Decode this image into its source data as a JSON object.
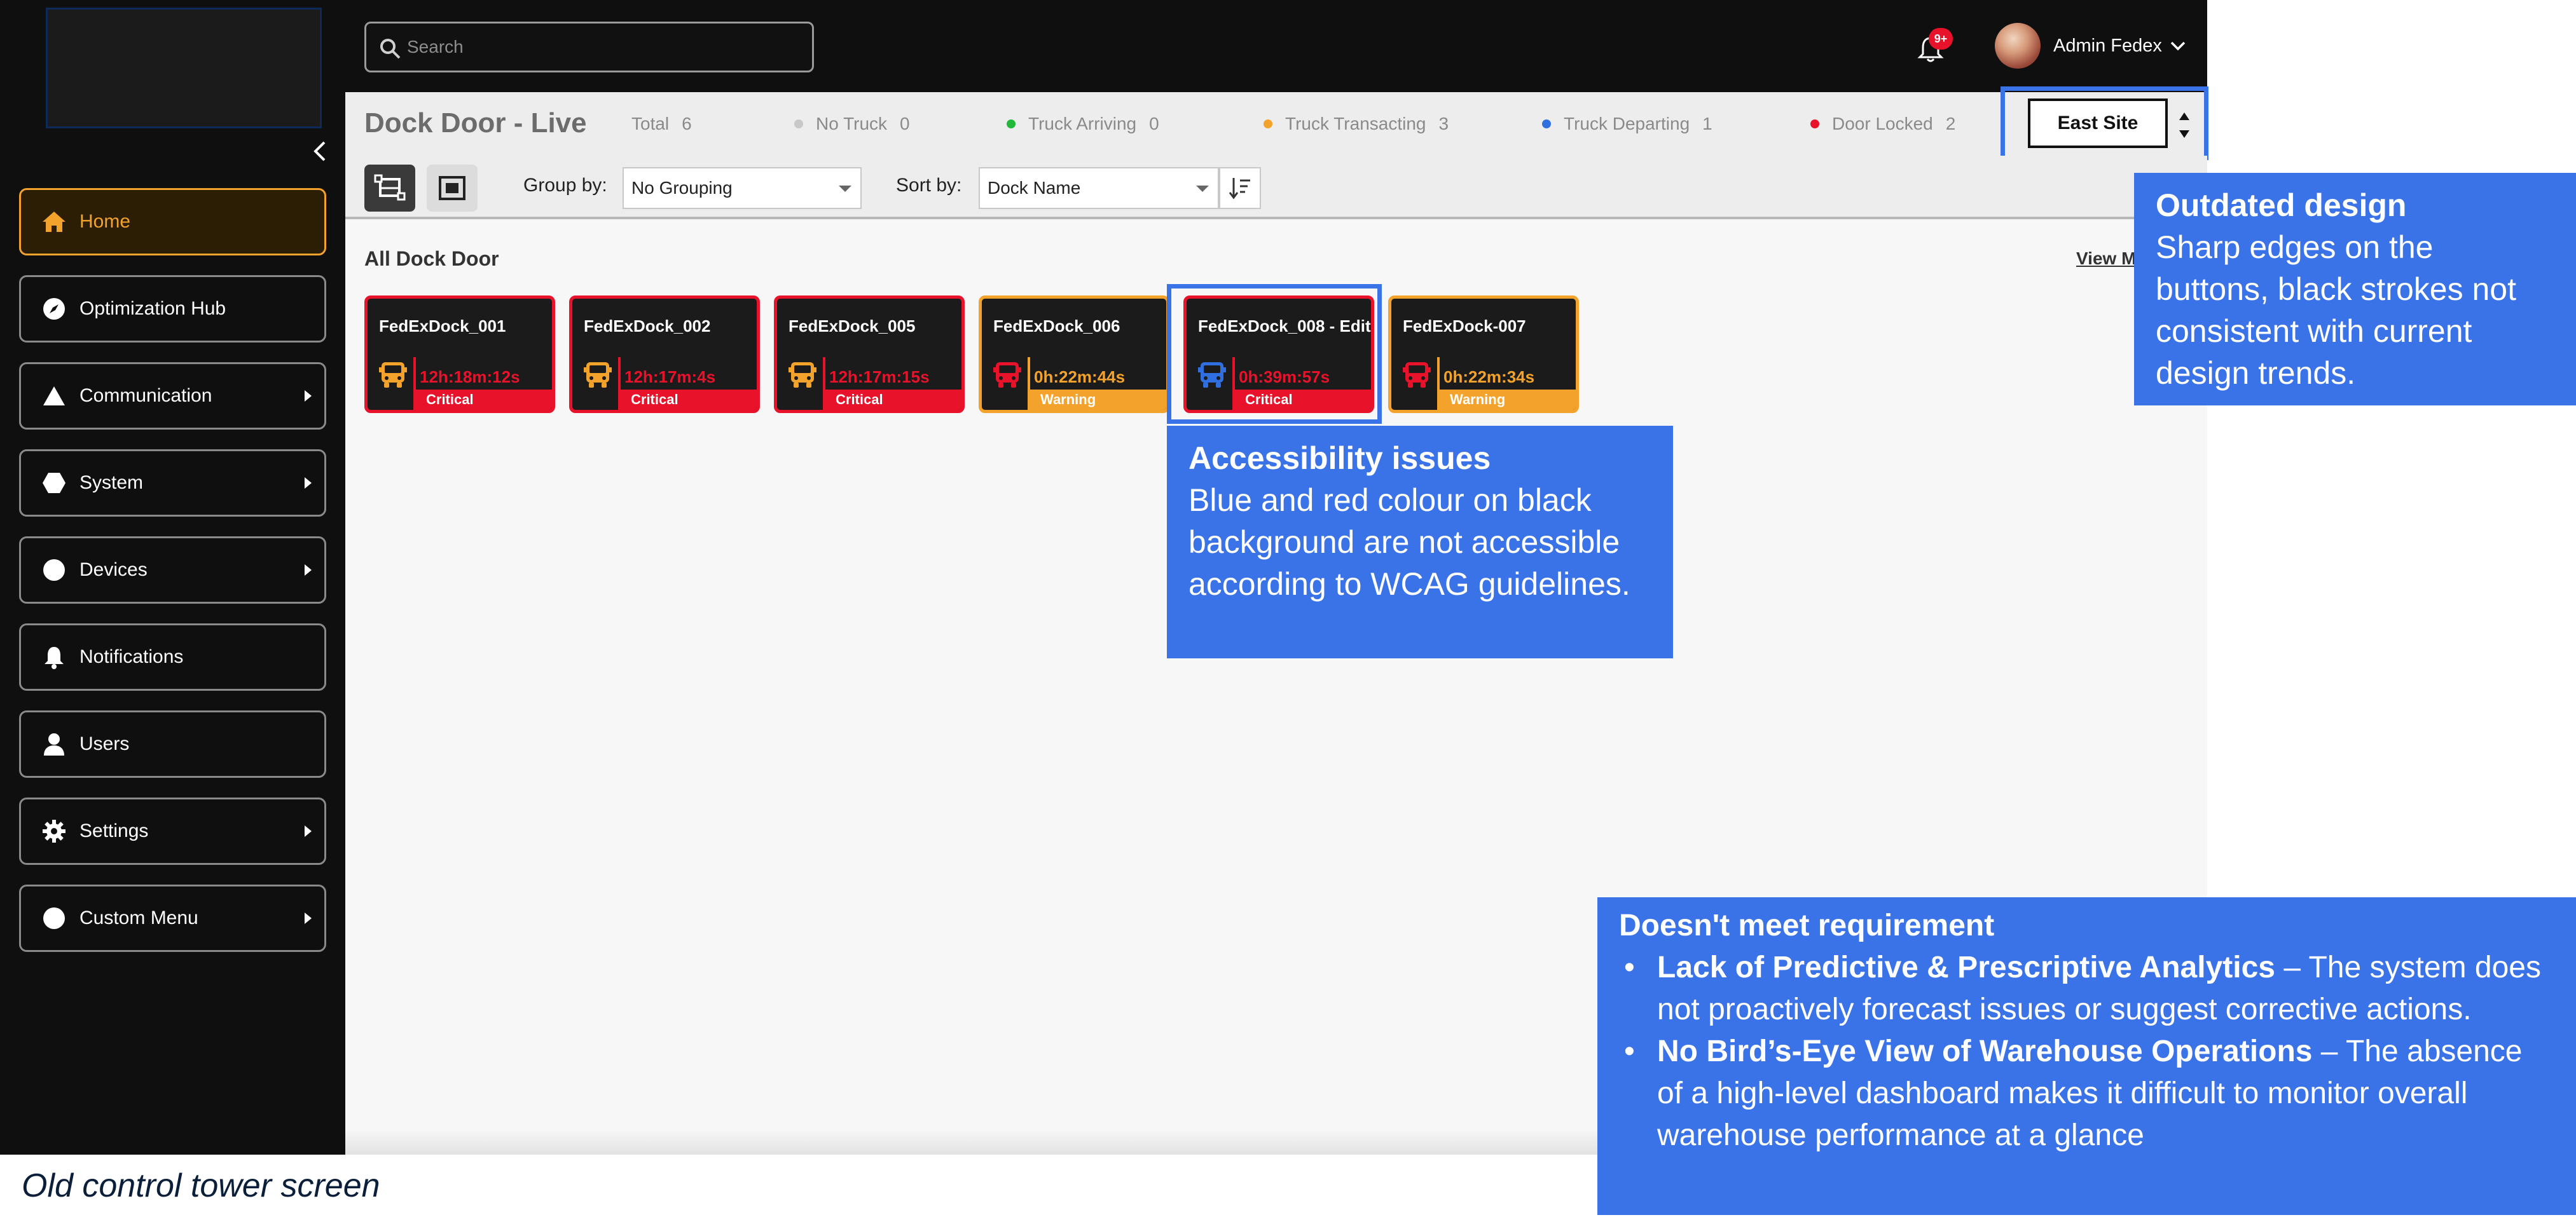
{
  "search": {
    "placeholder": "Search"
  },
  "header": {
    "notification_badge": "9+",
    "user_name": "Admin Fedex"
  },
  "sidebar": {
    "items": [
      {
        "label": "Home",
        "icon": "home-icon",
        "submenu": false
      },
      {
        "label": "Optimization Hub",
        "icon": "compass-icon",
        "submenu": false
      },
      {
        "label": "Communication",
        "icon": "triangle-icon",
        "submenu": true
      },
      {
        "label": "System",
        "icon": "hexagon-icon",
        "submenu": true
      },
      {
        "label": "Devices",
        "icon": "circle-icon",
        "submenu": true
      },
      {
        "label": "Notifications",
        "icon": "bell-icon",
        "submenu": false
      },
      {
        "label": "Users",
        "icon": "user-icon",
        "submenu": false
      },
      {
        "label": "Settings",
        "icon": "gear-icon",
        "submenu": true
      },
      {
        "label": "Custom Menu",
        "icon": "circle-icon",
        "submenu": true
      }
    ]
  },
  "status_bar": {
    "title": "Dock Door - Live",
    "total_label": "Total",
    "total_value": "6",
    "stats": [
      {
        "label": "No Truck",
        "value": "0",
        "color": "#c8c8c8"
      },
      {
        "label": "Truck Arriving",
        "value": "0",
        "color": "#22b83a"
      },
      {
        "label": "Truck Transacting",
        "value": "3",
        "color": "#f3a32b"
      },
      {
        "label": "Truck Departing",
        "value": "1",
        "color": "#2f6fe0"
      },
      {
        "label": "Door Locked",
        "value": "2",
        "color": "#e8122a"
      }
    ],
    "site": "East Site"
  },
  "toolbar": {
    "group_label": "Group by:",
    "group_value": "No Grouping",
    "sort_label": "Sort by:",
    "sort_value": "Dock Name"
  },
  "section": {
    "title": "All Dock Door",
    "view_more": "View More"
  },
  "docks": [
    {
      "name": "FedExDock_001",
      "time": "12h:18m:12s",
      "status": "Critical",
      "truck_color": "#f3a32b"
    },
    {
      "name": "FedExDock_002",
      "time": "12h:17m:4s",
      "status": "Critical",
      "truck_color": "#f3a32b"
    },
    {
      "name": "FedExDock_005",
      "time": "12h:17m:15s",
      "status": "Critical",
      "truck_color": "#f3a32b"
    },
    {
      "name": "FedExDock_006",
      "time": "0h:22m:44s",
      "status": "Warning",
      "truck_color": "#e8122a"
    },
    {
      "name": "FedExDock_008 - Edit",
      "time": "0h:39m:57s",
      "status": "Critical",
      "truck_color": "#2f6fe0"
    },
    {
      "name": "FedExDock-007",
      "time": "0h:22m:34s",
      "status": "Warning",
      "truck_color": "#e8122a"
    }
  ],
  "annotations": {
    "design_title": "Outdated design",
    "design_body": "Sharp edges on the buttons, black strokes not consistent with current design trends.",
    "access_title": "Accessibility issues",
    "access_body": "Blue and red colour on black background are not accessible according to WCAG guidelines.",
    "req_title": "Doesn't meet requirement",
    "req_item1_bold": "Lack of Predictive & Prescriptive Analytics",
    "req_item1_text": " – The system does not proactively forecast issues or suggest corrective actions.",
    "req_item2_bold": "No Bird’s-Eye View of Warehouse Operations",
    "req_item2_text": " – The absence of a high-level dashboard makes it difficult to monitor overall warehouse performance at a glance",
    "caption": "Old control tower screen"
  }
}
